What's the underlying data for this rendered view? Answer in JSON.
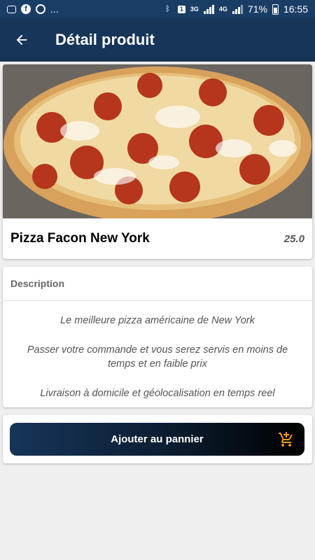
{
  "status_bar": {
    "left_overflow": "...",
    "network_3g": "3G",
    "network_4g": "4G",
    "sim_badge": "1",
    "battery": "71%",
    "time": "16:55"
  },
  "app_bar": {
    "title": "Détail produit",
    "back_icon": "arrow-left-icon"
  },
  "product": {
    "image_alt": "pizza",
    "name": "Pizza Facon New York",
    "price": "25.0"
  },
  "description": {
    "header": "Description",
    "lines": [
      "Le meilleure pizza américaine de New York",
      "Passer votre commande et vous serez servis en moins de temps et en faible prix",
      "Livraison à domicile et géolocalisation en temps reel"
    ]
  },
  "cart": {
    "button_label": "Ajouter au pannier",
    "icon": "shopping-cart-icon",
    "icon_color": "#f39c12"
  },
  "colors": {
    "app_bar": "#163559",
    "status_bar": "#1a3d66",
    "background": "#efefef"
  }
}
